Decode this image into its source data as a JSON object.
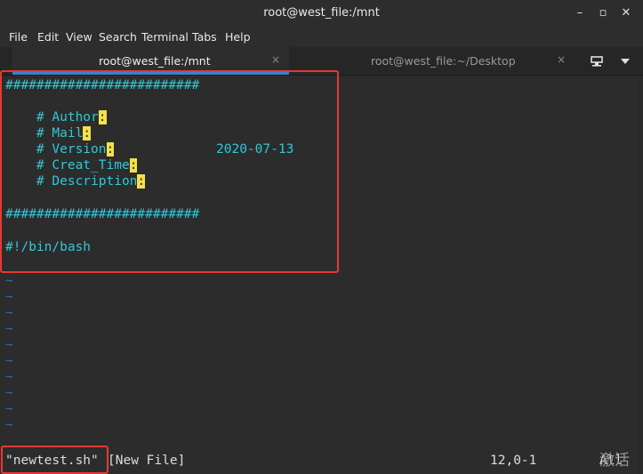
{
  "window": {
    "title": "root@west_file:/mnt",
    "minimize_glyph": "–",
    "maximize_glyph": "▫",
    "close_glyph": "✕"
  },
  "menu": [
    "File",
    "Edit",
    "View",
    "Search",
    "Terminal",
    "Tabs",
    "Help"
  ],
  "tabs": [
    {
      "label": "root@west_file:/mnt",
      "active": true
    },
    {
      "label": "root@west_file:~/Desktop",
      "active": false
    }
  ],
  "tab_close_glyph": "×",
  "editor": {
    "hash_line": "#########################",
    "author_label": "# Author",
    "mail_label": "# Mail",
    "version_label": "# Version",
    "creat_time_label": "# Creat_Time",
    "date_value": "2020-07-13",
    "description_label": "# Description",
    "colon": ":",
    "shebang": "#!/bin/bash",
    "tilde": "~"
  },
  "status": {
    "filename": "\"newtest.sh\"",
    "note": "[New File]",
    "position": "12,0-1",
    "scroll": "All"
  },
  "watermark": "激活"
}
